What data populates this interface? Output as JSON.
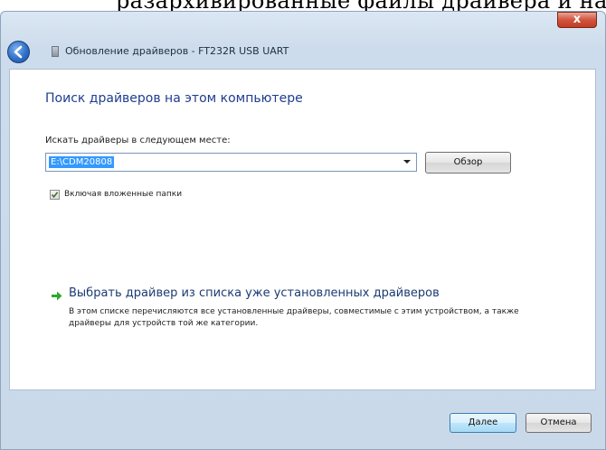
{
  "caption": {
    "clipped_text": "разархивированные файлы драйвера и на"
  },
  "window": {
    "title": "Обновление драйверов - FT232R USB UART",
    "close_glyph": "x"
  },
  "page": {
    "heading": "Поиск драйверов на этом компьютере",
    "search_label": "Искать драйверы в следующем месте:",
    "path_value": "E:\\CDM20808",
    "browse_label": "Обзор",
    "include_subfolders": {
      "label": "Включая вложенные папки",
      "checked": true
    },
    "pick_link": "Выбрать драйвер из списка уже установленных драйверов",
    "pick_description": "В этом списке перечисляются все установленные драйверы, совместимые с этим устройством, а также драйверы для устройств той же категории."
  },
  "footer": {
    "next_label": "Далее",
    "cancel_label": "Отмена"
  },
  "icons": {
    "back": "back-arrow-icon",
    "app": "driver-icon",
    "link_arrow": "green-arrow-icon",
    "checkmark": "checkmark-icon",
    "dropdown": "chevron-down-icon"
  },
  "colors": {
    "heading": "#1e3d8f",
    "selection": "#3399ff",
    "link_arrow": "#2ea82e",
    "close_button": "#c23c22"
  }
}
